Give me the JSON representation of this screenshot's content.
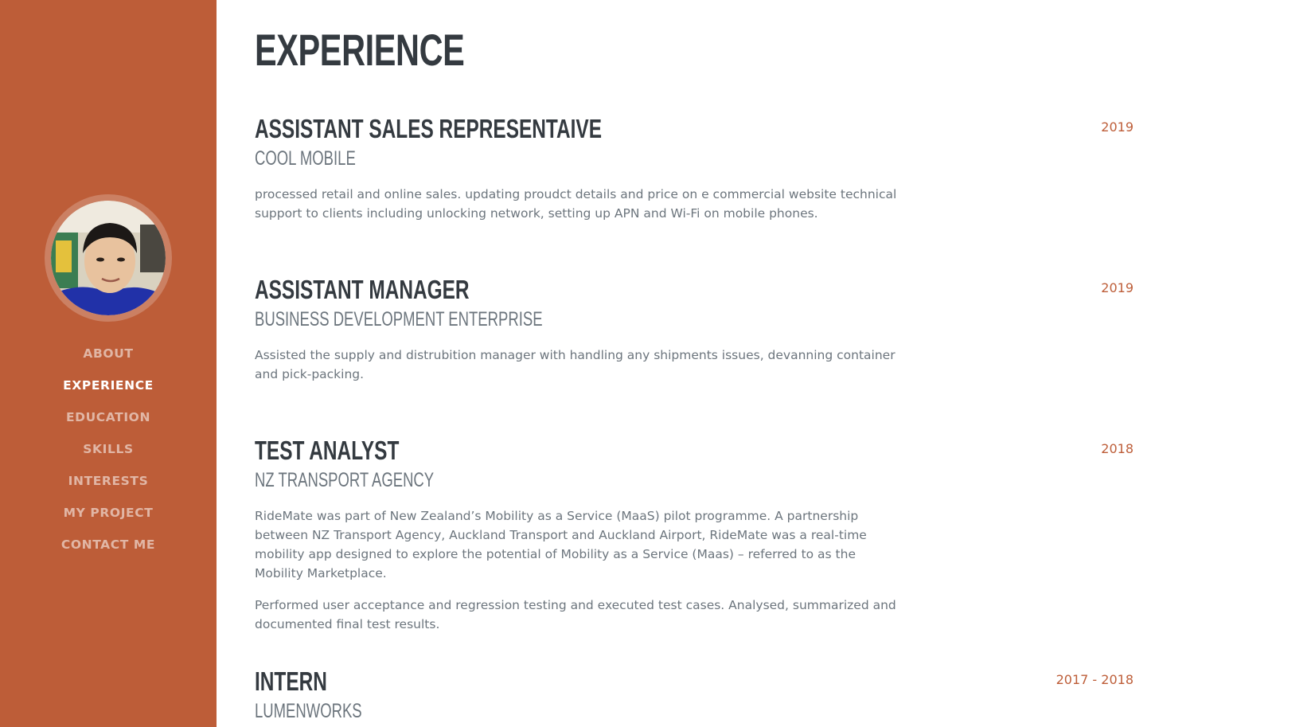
{
  "sidebar": {
    "nav": [
      {
        "label": "ABOUT",
        "active": false
      },
      {
        "label": "EXPERIENCE",
        "active": true
      },
      {
        "label": "EDUCATION",
        "active": false
      },
      {
        "label": "SKILLS",
        "active": false
      },
      {
        "label": "INTERESTS",
        "active": false
      },
      {
        "label": "MY PROJECT",
        "active": false
      },
      {
        "label": "CONTACT ME",
        "active": false
      }
    ]
  },
  "section": {
    "title": "EXPERIENCE"
  },
  "jobs": [
    {
      "title": "ASSISTANT SALES REPRESENTAIVE",
      "company": "COOL MOBILE",
      "date": "2019",
      "desc": [
        "processed retail and online sales. updating proudct details and price on e commercial website technical support to clients including unlocking network, setting up APN and Wi-Fi on mobile phones."
      ]
    },
    {
      "title": "ASSISTANT MANAGER",
      "company": "BUSINESS DEVELOPMENT ENTERPRISE",
      "date": "2019",
      "desc": [
        "Assisted the supply and distrubition manager with handling any shipments issues, devanning container and pick-packing."
      ]
    },
    {
      "title": "TEST ANALYST",
      "company": "NZ TRANSPORT AGENCY",
      "date": "2018",
      "desc": [
        "RideMate was part of New Zealand’s Mobility as a Service (MaaS) pilot programme. A partnership between NZ Transport Agency, Auckland Transport and Auckland Airport, RideMate was a real-time mobility app designed to explore the potential of Mobility as a Service (Maas) – referred to as the Mobility Marketplace.",
        "Performed user acceptance and regression testing and executed test cases. Analysed, summarized and documented final test results."
      ]
    },
    {
      "title": "INTERN",
      "company": "LUMENWORKS",
      "date": "2017 - 2018",
      "desc": []
    }
  ],
  "colors": {
    "sidebar": "#bd5d38",
    "heading": "#343a40",
    "muted": "#6c757d",
    "accent": "#bd5d38"
  }
}
